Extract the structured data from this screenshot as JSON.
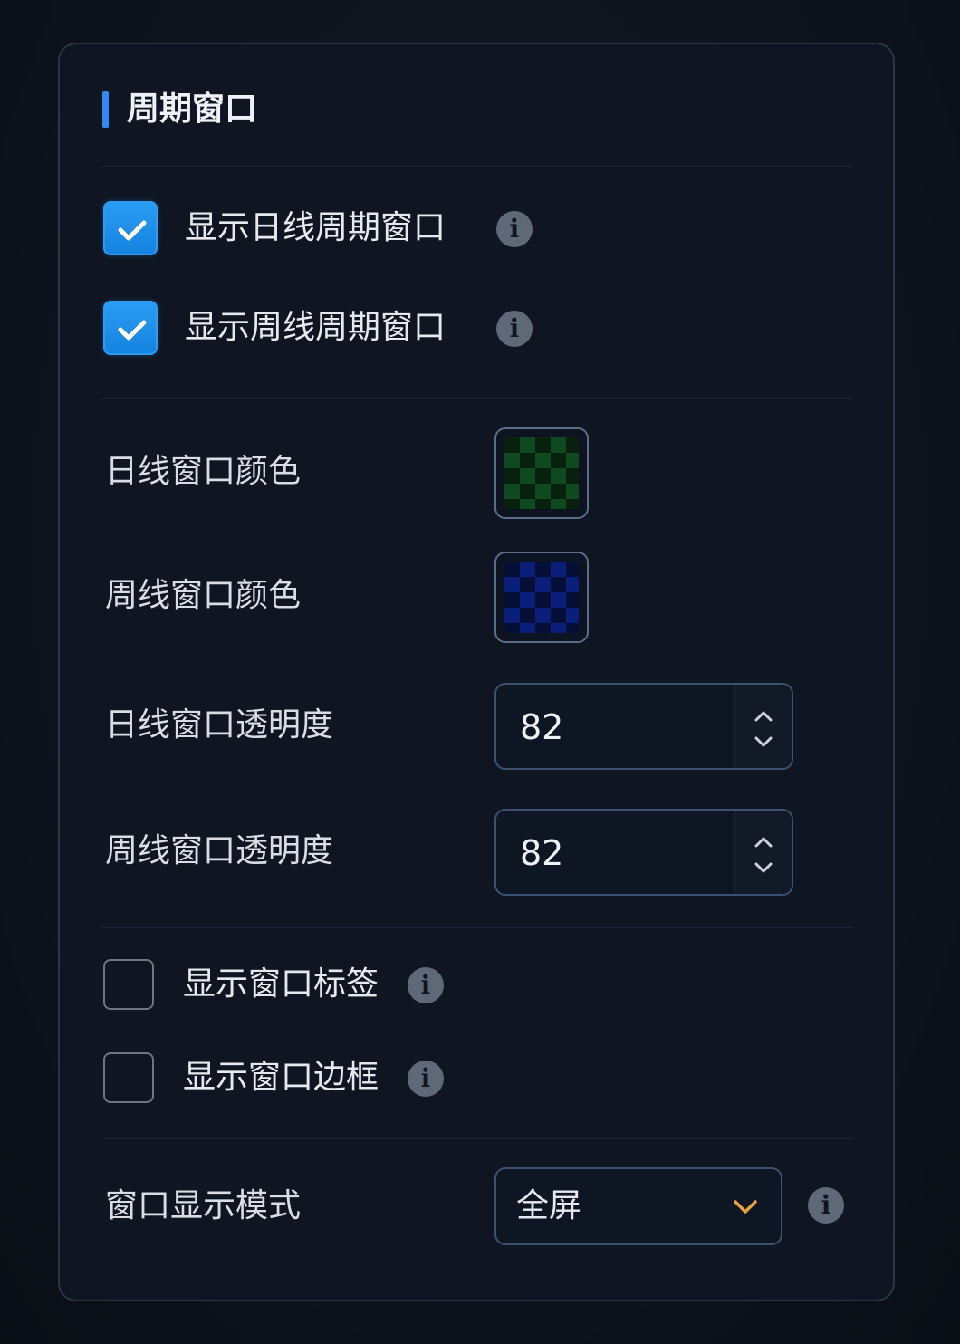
{
  "section": {
    "title": "周期窗口"
  },
  "options": {
    "show_daily_window": {
      "label": "显示日线周期窗口",
      "checked": true
    },
    "show_weekly_window": {
      "label": "显示周线周期窗口",
      "checked": true
    },
    "show_window_label": {
      "label": "显示窗口标签",
      "checked": false
    },
    "show_window_border": {
      "label": "显示窗口边框",
      "checked": false
    }
  },
  "colors": {
    "daily_label": "日线窗口颜色",
    "daily_color": "#0f4a1f",
    "weekly_label": "周线窗口颜色",
    "weekly_color": "#0a1f7a"
  },
  "opacity": {
    "daily_label": "日线窗口透明度",
    "daily_value": "82",
    "weekly_label": "周线窗口透明度",
    "weekly_value": "82"
  },
  "display_mode": {
    "label": "窗口显示模式",
    "selected": "全屏"
  },
  "theme": {
    "accent": "#2f8bf2",
    "chevron": "#e8a23a"
  }
}
